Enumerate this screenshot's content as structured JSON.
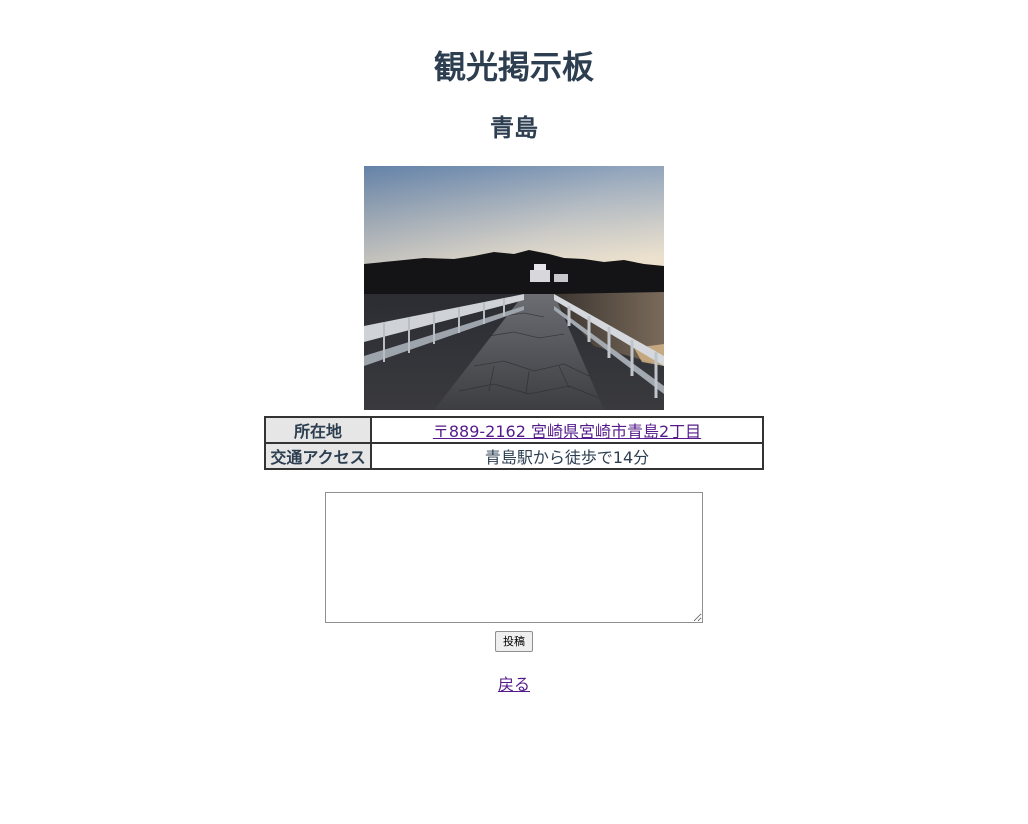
{
  "header": {
    "site_title": "観光掲示板"
  },
  "spot": {
    "name": "青島",
    "photo": {
      "alt": "青島",
      "icon": "bridge-sunset-photo"
    },
    "info_table": {
      "rows": [
        {
          "label": "所在地",
          "value": "〒889-2162 宮崎県宮崎市青島2丁目",
          "is_link": true
        },
        {
          "label": "交通アクセス",
          "value": "青島駅から徒歩で14分",
          "is_link": false
        }
      ]
    }
  },
  "comment_form": {
    "textarea_value": "",
    "post_button_label": "投稿"
  },
  "footer": {
    "back_link_label": "戻る"
  },
  "colors": {
    "heading": "#2c3e50",
    "link": "#551a8b",
    "table_header_bg": "#e6e6e6"
  }
}
